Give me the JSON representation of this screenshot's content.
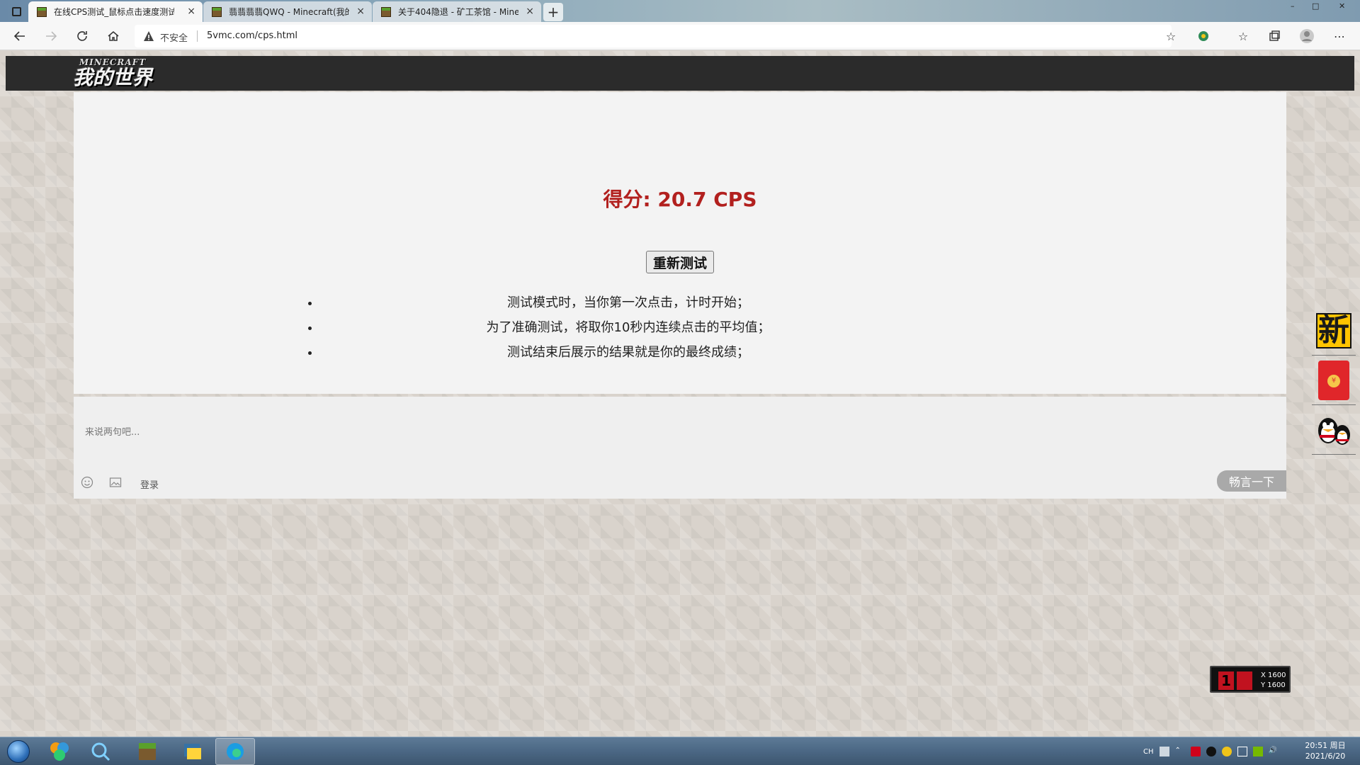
{
  "browser": {
    "tabs": [
      {
        "title": "在线CPS测试_鼠标点击速度测试",
        "close": "×"
      },
      {
        "title": "翡翡翡翡QWQ - Minecraft(我的世",
        "close": "×"
      },
      {
        "title": "关于404隐退 - 矿工茶馆 - Minec",
        "close": "×"
      }
    ],
    "new_tab": "+",
    "security_label": "不安全",
    "url": "5vmc.com/cps.html",
    "window_controls": [
      "–",
      "□",
      "✕"
    ]
  },
  "site": {
    "logo_top": "MINECRAFT",
    "logo_main": "我的世界"
  },
  "test": {
    "score_text": "得分: 20.7 CPS",
    "retest_label": "重新测试",
    "rules": [
      "测试模式时，当你第一次点击，计时开始；",
      "为了准确测试，将取你10秒内连续点击的平均值；",
      "测试结束后展示的结果就是你的最终成绩；"
    ]
  },
  "comments": {
    "placeholder": "来说两句吧...",
    "login_label": "登录",
    "submit_label": "畅言一下"
  },
  "side": {
    "new_badge": "新",
    "coin": "¥"
  },
  "cps_widget": {
    "number": "1",
    "x": "X 1600",
    "y": "Y 1600"
  },
  "taskbar": {
    "tray_lang": "CH",
    "time": "20:51 周日",
    "date": "2021/6/20"
  },
  "colors": {
    "score": "#b2201e",
    "header": "#2b2b2b",
    "submit": "#a9a9a9"
  }
}
